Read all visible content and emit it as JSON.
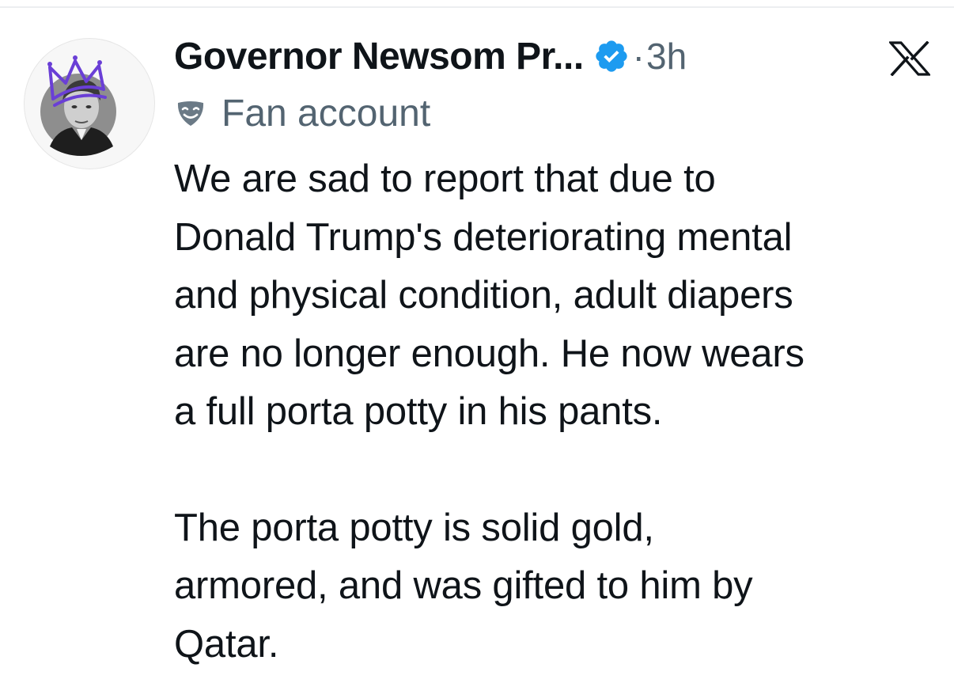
{
  "post": {
    "author_name": "Governor Newsom Pr...",
    "separator": "·",
    "timestamp": "3h",
    "account_label": "Fan account",
    "paragraphs": [
      {
        "lines": [
          "We are sad to report that due to",
          "Donald Trump's deteriorating mental",
          "and physical condition, adult diapers",
          "are no longer enough. He now wears",
          "a full porta potty in his pants."
        ]
      },
      {
        "lines": [
          "The porta potty is solid gold,",
          "armored, and was gifted to him by",
          "Qatar."
        ]
      }
    ]
  },
  "icons": {
    "avatar": "avatar-icon",
    "verified": "verified-badge-icon",
    "platform": "x-logo-icon",
    "fan_account": "drama-mask-icon"
  },
  "colors": {
    "text_primary": "#0f1419",
    "text_secondary": "#536471",
    "verified_blue": "#1d9bf0",
    "crown_purple": "#6a3fd6"
  }
}
